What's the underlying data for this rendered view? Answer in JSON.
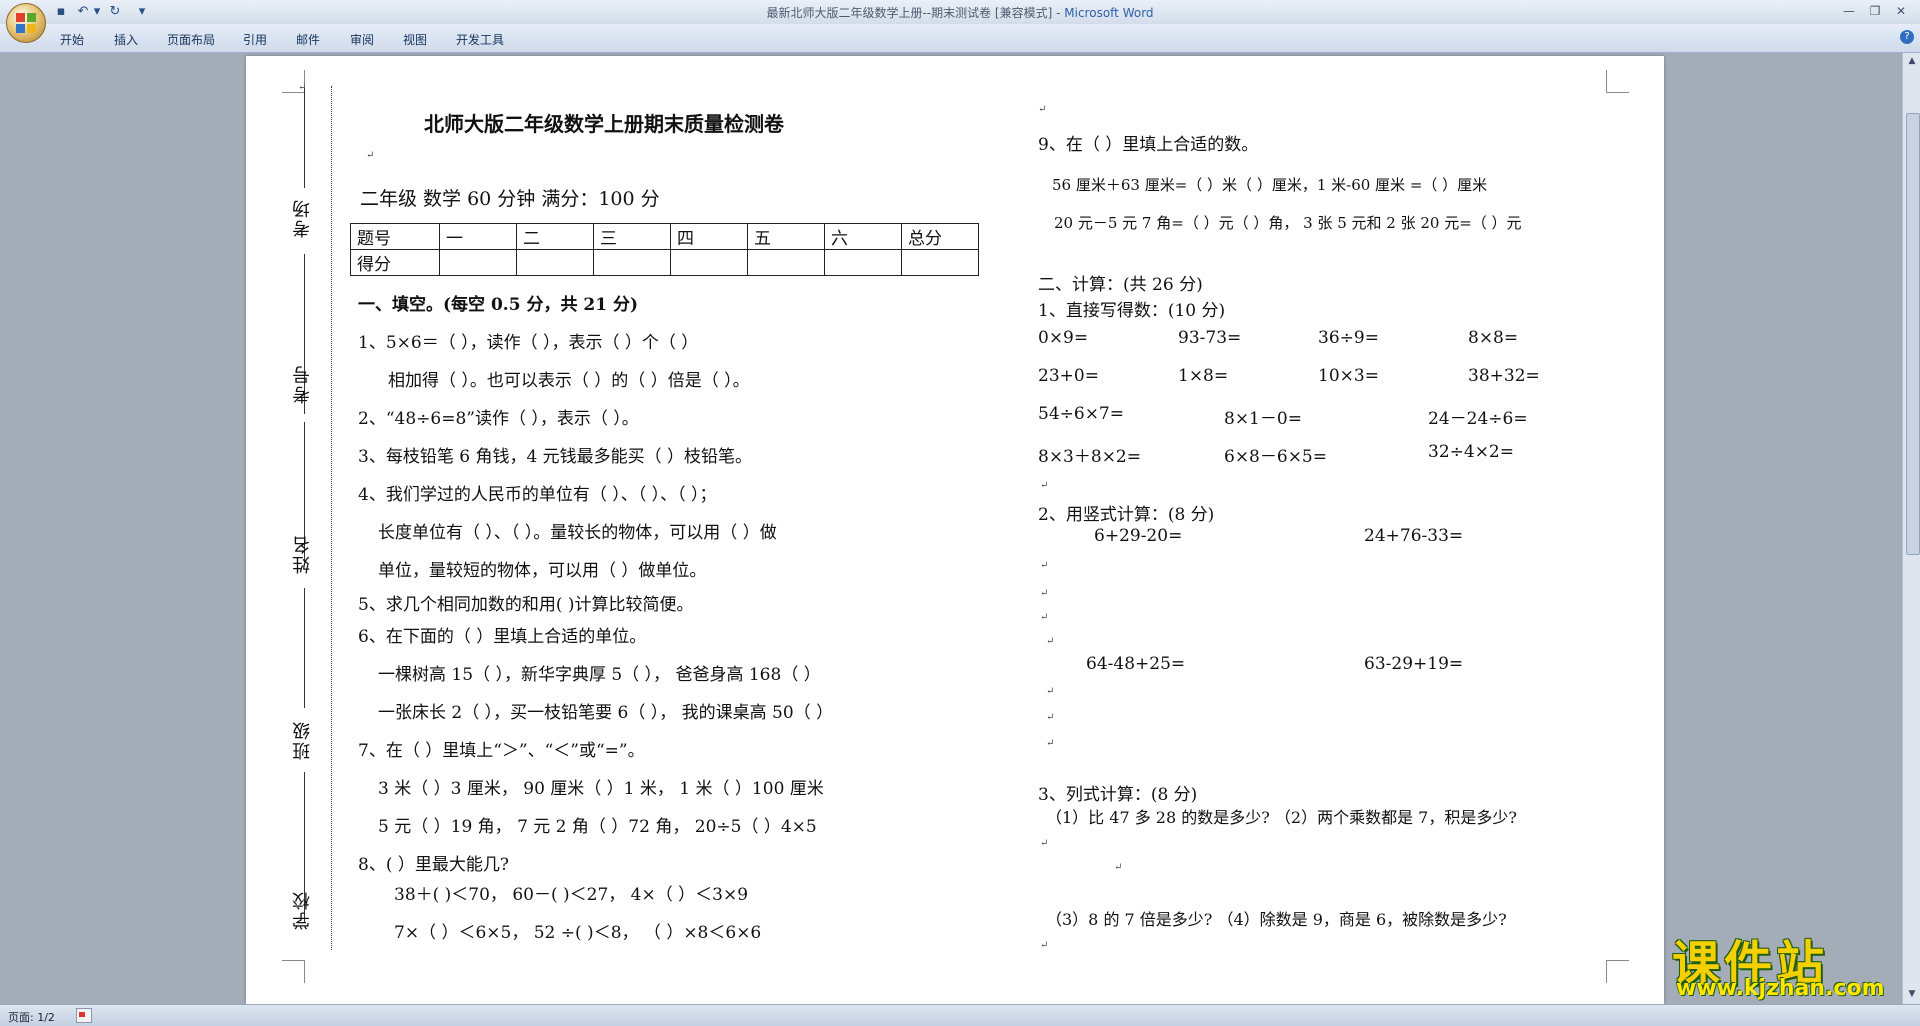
{
  "window": {
    "title": "最新北师大版二年级数学上册--期末测试卷 [兼容模式] - ",
    "app_name": "Microsoft Word",
    "minimize_icon": "minimize-icon",
    "maximize_icon": "restore-icon",
    "close_icon": "close-icon"
  },
  "quick_access": {
    "save": "save-icon",
    "undo": "undo-icon",
    "redo": "redo-icon",
    "customize": "▾"
  },
  "ribbon": {
    "tabs": [
      "开始",
      "插入",
      "页面布局",
      "引用",
      "邮件",
      "审阅",
      "视图",
      "开发工具"
    ],
    "help": "?"
  },
  "binding": {
    "labels": [
      "考场",
      "考号",
      "姓名",
      "班级",
      "学校"
    ]
  },
  "doc": {
    "title": "北师大版二年级数学上册期末质量检测卷",
    "meta": "二年级   数学     60 分钟        满分：100 分",
    "score_table": {
      "header": [
        "题号",
        "一",
        "二",
        "三",
        "四",
        "五",
        "六",
        "总分"
      ],
      "row_label": "得分"
    },
    "left": [
      {
        "text": "一、填空。(每空 0.5 分，共 21 分)",
        "bold": true
      },
      {
        "text": "1、5×6＝（    ），读作（                    ），表示（    ）个（    ）"
      },
      {
        "text": "相加得（     ）。也可以表示（      ）的（      ）倍是（          ）。"
      },
      {
        "text": "2、“48÷6=8”读作（               ），表示（                              ）。"
      },
      {
        "text": "3、每枝铅笔 6 角钱，4 元钱最多能买（       ）枝铅笔。"
      },
      {
        "text": "4、我们学过的人民币的单位有（        ）、（         ）、（       ）；"
      },
      {
        "text": "长度单位有（      ）、（        ）。量较长的物体，可以用（         ）做"
      },
      {
        "text": "单位，量较短的物体，可以用（        ）做单位。"
      },
      {
        "text": "5、求几个相同加数的和用(          )计算比较简便。"
      },
      {
        "text": "6、在下面的（  ）里填上合适的单位。"
      },
      {
        "text": "一棵树高 15（    ），新华字典厚 5（    ），  爸爸身高 168（      ）"
      },
      {
        "text": "一张床长 2（     ），买一枝铅笔要 6（    ），  我的课桌高 50（    ）"
      },
      {
        "text": "7、在（  ）里填上“＞”、“＜”或“=”。"
      },
      {
        "text": "3 米（    ）3 厘米，  90 厘米（    ）1 米，  1 米（    ）100 厘米"
      },
      {
        "text": "5 元（    ）19 角，  7 元 2 角（    ）72 角，  20÷5（    ）4×5"
      },
      {
        "text": "8、(  ）里最大能几?"
      },
      {
        "text": "38＋(  )＜70，     60－(      )＜27，      4×（    ）＜3×9"
      },
      {
        "text": "7×（   ）＜6×5，    52 ÷(      )＜8，   （      ）×8＜6×6"
      }
    ],
    "right": [
      {
        "text": "9、在（  ）里填上合适的数。"
      },
      {
        "text": "56 厘米＋63 厘米=（     ）米（      ）厘米，1 米-60 厘米 =（      ）厘米"
      },
      {
        "text": "20 元－5 元 7 角=（    ）元（    ）角，     3 张 5 元和 2 张 20 元=（    ）元"
      },
      {
        "text": "二、计算：(共 26 分)"
      },
      {
        "text": "1、直接写得数：(10 分)"
      },
      {
        "row": [
          "0×9=",
          "93-73=",
          "36÷9=",
          "8×8="
        ]
      },
      {
        "row": [
          "23+0=",
          "1×8=",
          "10×3=",
          "38+32="
        ]
      },
      {
        "row": [
          "54÷6×7=",
          "8×1－0=",
          "24－24÷6="
        ]
      },
      {
        "row": [
          "8×3＋8×2=",
          "6×8－6×5=",
          "32÷4×2="
        ]
      },
      {
        "text": "2、用竖式计算：(8 分)"
      },
      {
        "row": [
          "6+29-20=",
          "24+76-33="
        ]
      },
      {
        "row": [
          "64-48+25=",
          "63-29+19="
        ]
      },
      {
        "text": "3、列式计算：(8 分)"
      },
      {
        "text": "（1）比 47 多 28 的数是多少?    （2）两个乘数都是 7，积是多少?"
      },
      {
        "text": "（3）8 的 7 倍是多少?    （4）除数是 9，商是 6，被除数是多少?"
      }
    ]
  },
  "paragraph_mark": "↵",
  "statusbar": {
    "page": "页面: 1/2"
  },
  "watermark": {
    "name": "课件站",
    "url": "www.kjzhan.com"
  }
}
